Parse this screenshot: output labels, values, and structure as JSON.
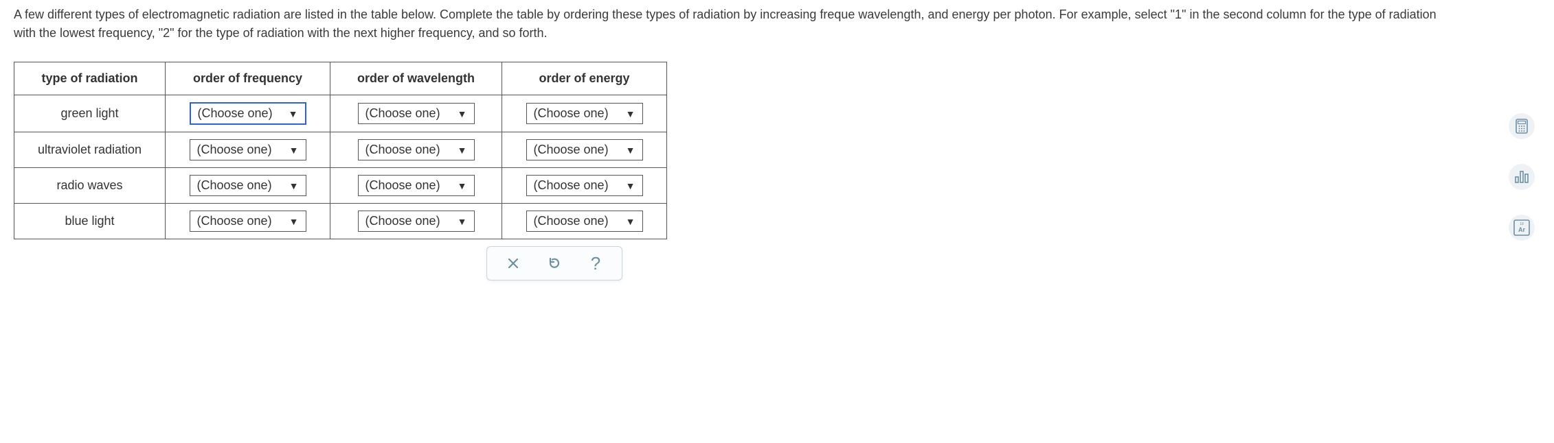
{
  "instructions": "A few different types of electromagnetic radiation are listed in the table below. Complete the table by ordering these types of radiation by increasing freque wavelength, and energy per photon. For example, select \"1\" in the second column for the type of radiation with the lowest frequency, \"2\" for the type of radiation with the next higher frequency, and so forth.",
  "table": {
    "headers": {
      "type": "type of radiation",
      "frequency": "order of frequency",
      "wavelength": "order of wavelength",
      "energy": "order of energy"
    },
    "rows": [
      {
        "type": "green light",
        "freq": "(Choose one)",
        "wave": "(Choose one)",
        "energy": "(Choose one)"
      },
      {
        "type": "ultraviolet radiation",
        "freq": "(Choose one)",
        "wave": "(Choose one)",
        "energy": "(Choose one)"
      },
      {
        "type": "radio waves",
        "freq": "(Choose one)",
        "wave": "(Choose one)",
        "energy": "(Choose one)"
      },
      {
        "type": "blue light",
        "freq": "(Choose one)",
        "wave": "(Choose one)",
        "energy": "(Choose one)"
      }
    ]
  },
  "controls": {
    "clear": "✕",
    "reset": "↺",
    "help": "?"
  },
  "sidebar": {
    "calculator": "calc",
    "stats": "bars",
    "periodic": "Ar"
  }
}
